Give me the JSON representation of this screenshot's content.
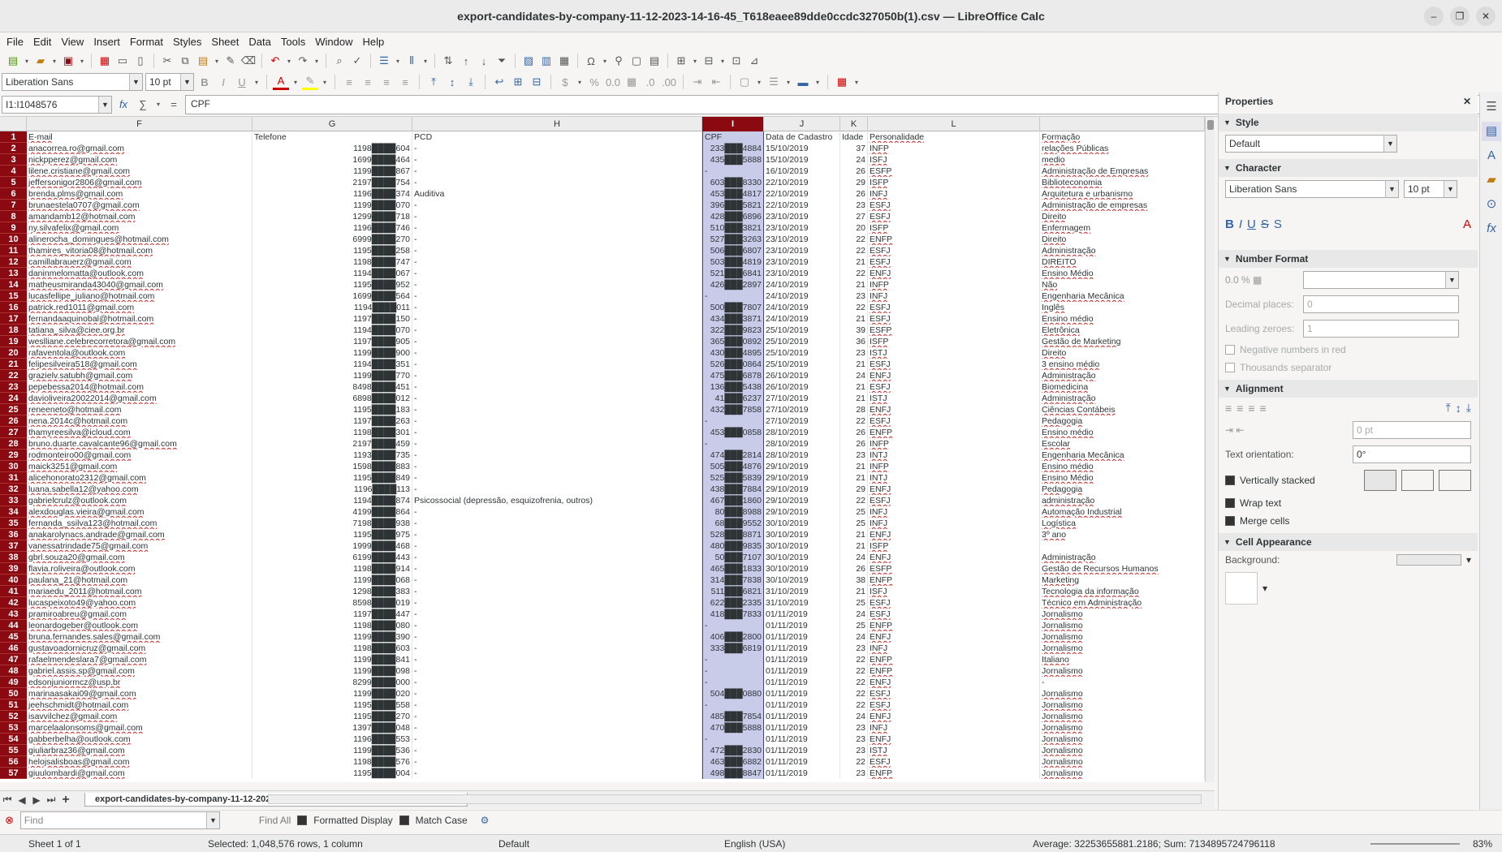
{
  "window": {
    "title": "export-candidates-by-company-11-12-2023-14-16-45_T618eaee89dde0ccdc327050b(1).csv — LibreOffice Calc"
  },
  "menu": [
    "File",
    "Edit",
    "View",
    "Insert",
    "Format",
    "Styles",
    "Sheet",
    "Data",
    "Tools",
    "Window",
    "Help"
  ],
  "format_bar": {
    "font_name": "Liberation Sans",
    "font_size": "10 pt"
  },
  "formula_bar": {
    "name_box": "I1:I1048576",
    "content": "CPF"
  },
  "columns": [
    {
      "id": "F",
      "label": "F"
    },
    {
      "id": "G",
      "label": "G"
    },
    {
      "id": "H",
      "label": "H"
    },
    {
      "id": "I",
      "label": "I"
    },
    {
      "id": "J",
      "label": "J"
    },
    {
      "id": "K",
      "label": "K"
    },
    {
      "id": "L",
      "label": "L"
    },
    {
      "id": "M",
      "label": ""
    }
  ],
  "rows": [
    {
      "n": "1",
      "email": "E-mail",
      "tel": "Telefone",
      "pcd": "PCD",
      "cpf": "CPF",
      "date": "Data de Cadastro",
      "age": "Idade",
      "pers": "Personalidade",
      "form": "Formação"
    },
    {
      "n": "2",
      "email": "anacorrea.ro@gmail.com",
      "tel": "1198████604",
      "pcd": "-",
      "cpf": "233███4884",
      "date": "15/10/2019",
      "age": "37",
      "pers": "INFP",
      "form": "relações Públicas"
    },
    {
      "n": "3",
      "email": "nickpperez@gmail.com",
      "tel": "1699████464",
      "pcd": "-",
      "cpf": "435███5888",
      "date": "15/10/2019",
      "age": "24",
      "pers": "ISFJ",
      "form": "medio"
    },
    {
      "n": "4",
      "email": "lilene.cristiane@gmail.com",
      "tel": "1199████867",
      "pcd": "-",
      "cpf": "-",
      "date": "16/10/2019",
      "age": "26",
      "pers": "ESFP",
      "form": "Administração de Empresas"
    },
    {
      "n": "5",
      "email": "jeffersonigor2806@gmail.com",
      "tel": "2197████754",
      "pcd": "-",
      "cpf": "603███8330",
      "date": "22/10/2019",
      "age": "29",
      "pers": "ISFP",
      "form": "Biblioteconomia"
    },
    {
      "n": "6",
      "email": "brenda.plms@gmail.com",
      "tel": "1196████374",
      "pcd": "Auditiva",
      "cpf": "453███4817",
      "date": "22/10/2019",
      "age": "26",
      "pers": "INFJ",
      "form": "Arquitetura e urbanismo"
    },
    {
      "n": "7",
      "email": "brunaestela0707@gmail.com",
      "tel": "1199████070",
      "pcd": "-",
      "cpf": "396███5821",
      "date": "22/10/2019",
      "age": "23",
      "pers": "ESFJ",
      "form": "Administração de empresas"
    },
    {
      "n": "8",
      "email": "amandamb12@hotmail.com",
      "tel": "1299████718",
      "pcd": "-",
      "cpf": "428███6896",
      "date": "23/10/2019",
      "age": "27",
      "pers": "ESFJ",
      "form": "Direito"
    },
    {
      "n": "9",
      "email": "ny.silvafelix@gmail.com",
      "tel": "1196████746",
      "pcd": "-",
      "cpf": "510███3821",
      "date": "23/10/2019",
      "age": "20",
      "pers": "ISFP",
      "form": "Enfermagem"
    },
    {
      "n": "10",
      "email": "alinerocha_domingues@hotmail.com",
      "tel": "6999████270",
      "pcd": "-",
      "cpf": "527███3263",
      "date": "23/10/2019",
      "age": "22",
      "pers": "ENFP",
      "form": "Direito"
    },
    {
      "n": "11",
      "email": "thamires_vitoria08@hotmail.com",
      "tel": "1195████258",
      "pcd": "-",
      "cpf": "506███6807",
      "date": "23/10/2019",
      "age": "22",
      "pers": "ESFJ",
      "form": "Administração"
    },
    {
      "n": "12",
      "email": "camillabrauerz@gmail.com",
      "tel": "1198████747",
      "pcd": "-",
      "cpf": "503███4819",
      "date": "23/10/2019",
      "age": "21",
      "pers": "ESFJ",
      "form": "DIREITO"
    },
    {
      "n": "13",
      "email": "daninmelomatta@outlook.com",
      "tel": "1194████067",
      "pcd": "-",
      "cpf": "521███6841",
      "date": "23/10/2019",
      "age": "22",
      "pers": "ENFJ",
      "form": "Ensino Médio"
    },
    {
      "n": "14",
      "email": "matheusmiranda43040@gmail.com",
      "tel": "1195████952",
      "pcd": "-",
      "cpf": "426███2897",
      "date": "24/10/2019",
      "age": "21",
      "pers": "INFP",
      "form": "Não"
    },
    {
      "n": "15",
      "email": "lucasfellipe_juliano@hotmail.com",
      "tel": "1699████564",
      "pcd": "-",
      "cpf": "-",
      "date": "24/10/2019",
      "age": "23",
      "pers": "INFJ",
      "form": "Engenharia Mecânica"
    },
    {
      "n": "16",
      "email": "patrick.red1011@gmail.com",
      "tel": "1194████011",
      "pcd": "-",
      "cpf": "500███7807",
      "date": "24/10/2019",
      "age": "22",
      "pers": "ESFJ",
      "form": "Inglês"
    },
    {
      "n": "17",
      "email": "fernandaaquinobal@hotmail.com",
      "tel": "1197████150",
      "pcd": "-",
      "cpf": "434███3871",
      "date": "24/10/2019",
      "age": "21",
      "pers": "ESFJ",
      "form": "Ensino médio"
    },
    {
      "n": "18",
      "email": "tatiana_silva@ciee.org.br",
      "tel": "1194████070",
      "pcd": "-",
      "cpf": "322███9823",
      "date": "25/10/2019",
      "age": "39",
      "pers": "ESFP",
      "form": "Eletrônica"
    },
    {
      "n": "19",
      "email": "weslliane.celebrecorretora@gmail.com",
      "tel": "1197████905",
      "pcd": "-",
      "cpf": "365███0892",
      "date": "25/10/2019",
      "age": "36",
      "pers": "ISFP",
      "form": "Gestão de Marketing"
    },
    {
      "n": "20",
      "email": "rafaventola@outlook.com",
      "tel": "1199████900",
      "pcd": "-",
      "cpf": "430███4895",
      "date": "25/10/2019",
      "age": "23",
      "pers": "ISTJ",
      "form": "Direito"
    },
    {
      "n": "21",
      "email": "felipesilveira518@gmail.com",
      "tel": "1194████351",
      "pcd": "-",
      "cpf": "526███0864",
      "date": "25/10/2019",
      "age": "21",
      "pers": "ESFJ",
      "form": "3 ensino médio"
    },
    {
      "n": "22",
      "email": "grazielv.satubh@gmail.com",
      "tel": "1199████770",
      "pcd": "-",
      "cpf": "475███6878",
      "date": "26/10/2019",
      "age": "24",
      "pers": "ENFJ",
      "form": "Administração"
    },
    {
      "n": "23",
      "email": "pepebessa2014@hotmail.com",
      "tel": "8498████451",
      "pcd": "-",
      "cpf": "136███5438",
      "date": "26/10/2019",
      "age": "21",
      "pers": "ESFJ",
      "form": "Biomedicina"
    },
    {
      "n": "24",
      "email": "davioliveira20022014@gmail.com",
      "tel": "6898████012",
      "pcd": "-",
      "cpf": "41███6237",
      "date": "27/10/2019",
      "age": "21",
      "pers": "ISTJ",
      "form": "Administração"
    },
    {
      "n": "25",
      "email": "reneeneto@hotmail.com",
      "tel": "1195████183",
      "pcd": "-",
      "cpf": "432███7858",
      "date": "27/10/2019",
      "age": "28",
      "pers": "ENFJ",
      "form": "Ciências Contábeis"
    },
    {
      "n": "26",
      "email": "nena.2014c@hotmail.com",
      "tel": "1197████263",
      "pcd": "-",
      "cpf": "-",
      "date": "27/10/2019",
      "age": "22",
      "pers": "ESFJ",
      "form": "Pedagogia"
    },
    {
      "n": "27",
      "email": "thamyreesilva@icloud.com",
      "tel": "1198████301",
      "pcd": "-",
      "cpf": "453███0858",
      "date": "28/10/2019",
      "age": "26",
      "pers": "ENFP",
      "form": "Ensino médio"
    },
    {
      "n": "28",
      "email": "bruno.duarte.cavalcante96@gmail.com",
      "tel": "2197████459",
      "pcd": "-",
      "cpf": "-",
      "date": "28/10/2019",
      "age": "26",
      "pers": "INFP",
      "form": "Escolar"
    },
    {
      "n": "29",
      "email": "rodmonteiro00@gmail.com",
      "tel": "1193████735",
      "pcd": "-",
      "cpf": "474███2814",
      "date": "28/10/2019",
      "age": "23",
      "pers": "INTJ",
      "form": "Engenharia Mecânica"
    },
    {
      "n": "30",
      "email": "maick3251@gmail.com",
      "tel": "1598████883",
      "pcd": "-",
      "cpf": "505███4876",
      "date": "29/10/2019",
      "age": "21",
      "pers": "INFP",
      "form": "Ensino médio"
    },
    {
      "n": "31",
      "email": "alicehonorato2312@gmail.com",
      "tel": "1195████849",
      "pcd": "-",
      "cpf": "525███5839",
      "date": "29/10/2019",
      "age": "21",
      "pers": "INTJ",
      "form": "Ensino Médio"
    },
    {
      "n": "32",
      "email": "luana.sabella12@yahoo.com",
      "tel": "1196████113",
      "pcd": "-",
      "cpf": "438███7884",
      "date": "29/10/2019",
      "age": "29",
      "pers": "ENFJ",
      "form": "Pedagogia"
    },
    {
      "n": "33",
      "email": "gabrielcrulz@outlook.com",
      "tel": "1194████874",
      "pcd": "Psicossocial (depressão, esquizofrenia, outros)",
      "cpf": "467███1860",
      "date": "29/10/2019",
      "age": "22",
      "pers": "ESFJ",
      "form": "administração"
    },
    {
      "n": "34",
      "email": "alexdouglas.vieira@gmail.com",
      "tel": "4199████864",
      "pcd": "-",
      "cpf": "80███8988",
      "date": "29/10/2019",
      "age": "25",
      "pers": "INFJ",
      "form": "Automação Industrial"
    },
    {
      "n": "35",
      "email": "fernanda_ssilva123@hotmail.com",
      "tel": "7198████938",
      "pcd": "-",
      "cpf": "68███9552",
      "date": "30/10/2019",
      "age": "25",
      "pers": "INFJ",
      "form": "Logística"
    },
    {
      "n": "36",
      "email": "anakarolynacs.andrade@gmail.com",
      "tel": "1195████975",
      "pcd": "-",
      "cpf": "528███8871",
      "date": "30/10/2019",
      "age": "21",
      "pers": "ENFJ",
      "form": "3º ano"
    },
    {
      "n": "37",
      "email": "vanessatrindade75@gmail.com",
      "tel": "1999████468",
      "pcd": "-",
      "cpf": "480███9835",
      "date": "30/10/2019",
      "age": "21",
      "pers": "ISFP",
      "form": ""
    },
    {
      "n": "38",
      "email": "gbrl.souza20@gmail.com",
      "tel": "6199████443",
      "pcd": "-",
      "cpf": "50███7107",
      "date": "30/10/2019",
      "age": "24",
      "pers": "ENFJ",
      "form": "Administração"
    },
    {
      "n": "39",
      "email": "flavia.roliveira@outlook.com",
      "tel": "1198████914",
      "pcd": "-",
      "cpf": "465███1833",
      "date": "30/10/2019",
      "age": "26",
      "pers": "ESFP",
      "form": "Gestão de Recursos Humanos"
    },
    {
      "n": "40",
      "email": "paulana_21@hotmail.com",
      "tel": "1199████068",
      "pcd": "-",
      "cpf": "314███7838",
      "date": "30/10/2019",
      "age": "38",
      "pers": "ENFP",
      "form": "Marketing"
    },
    {
      "n": "41",
      "email": "mariaedu_2011@hotmail.com",
      "tel": "1298████383",
      "pcd": "-",
      "cpf": "511███6821",
      "date": "31/10/2019",
      "age": "21",
      "pers": "ISFJ",
      "form": "Tecnologia da informação"
    },
    {
      "n": "42",
      "email": "lucaspeixoto49@yahoo.com",
      "tel": "8598████019",
      "pcd": "-",
      "cpf": "622███2335",
      "date": "31/10/2019",
      "age": "25",
      "pers": "ESFJ",
      "form": "Técnico em Administração"
    },
    {
      "n": "43",
      "email": "pramiroabreu@gmail.com",
      "tel": "1197████447",
      "pcd": "-",
      "cpf": "418███7833",
      "date": "01/11/2019",
      "age": "24",
      "pers": "ESFJ",
      "form": "Jornalismo"
    },
    {
      "n": "44",
      "email": "leonardogeber@outlook.com",
      "tel": "1198████080",
      "pcd": "-",
      "cpf": "-",
      "date": "01/11/2019",
      "age": "25",
      "pers": "ENFP",
      "form": "Jornalismo"
    },
    {
      "n": "45",
      "email": "bruna.fernandes.sales@gmail.com",
      "tel": "1199████390",
      "pcd": "-",
      "cpf": "406███2800",
      "date": "01/11/2019",
      "age": "24",
      "pers": "ENFJ",
      "form": "Jornalismo"
    },
    {
      "n": "46",
      "email": "gustavoadornicruz@gmail.com",
      "tel": "1198████603",
      "pcd": "-",
      "cpf": "333███6819",
      "date": "01/11/2019",
      "age": "23",
      "pers": "INFJ",
      "form": "Jornalismo"
    },
    {
      "n": "47",
      "email": "rafaelmendeslara7@gmail.com",
      "tel": "1199████841",
      "pcd": "-",
      "cpf": "-",
      "date": "01/11/2019",
      "age": "22",
      "pers": "ENFP",
      "form": "Italiano"
    },
    {
      "n": "48",
      "email": "gabriel.assis.sp@gmail.com",
      "tel": "1199████098",
      "pcd": "-",
      "cpf": "-",
      "date": "01/11/2019",
      "age": "22",
      "pers": "ENFP",
      "form": "Jornalismo"
    },
    {
      "n": "49",
      "email": "edsonjuniormcz@usp.br",
      "tel": "8299████000",
      "pcd": "-",
      "cpf": "-",
      "date": "01/11/2019",
      "age": "22",
      "pers": "ENFJ",
      "form": "-"
    },
    {
      "n": "50",
      "email": "marinaasakai09@gmail.com",
      "tel": "1199████020",
      "pcd": "-",
      "cpf": "504███0880",
      "date": "01/11/2019",
      "age": "22",
      "pers": "ESFJ",
      "form": "Jornalismo"
    },
    {
      "n": "51",
      "email": "jeehschmidt@hotmail.com",
      "tel": "1195████558",
      "pcd": "-",
      "cpf": "-",
      "date": "01/11/2019",
      "age": "22",
      "pers": "ESFJ",
      "form": "Jornalismo"
    },
    {
      "n": "52",
      "email": "isavvilchez@gmail.com",
      "tel": "1195████270",
      "pcd": "-",
      "cpf": "485███7854",
      "date": "01/11/2019",
      "age": "24",
      "pers": "ENFJ",
      "form": "Jornalismo"
    },
    {
      "n": "53",
      "email": "marcelaalonsoms@gmail.com",
      "tel": "1397████048",
      "pcd": "-",
      "cpf": "470███5888",
      "date": "01/11/2019",
      "age": "23",
      "pers": "INFJ",
      "form": "Jornalismo"
    },
    {
      "n": "54",
      "email": "gabberbelha@outlook.com",
      "tel": "1196████553",
      "pcd": "-",
      "cpf": "-",
      "date": "01/11/2019",
      "age": "23",
      "pers": "ENFJ",
      "form": "Jornalismo"
    },
    {
      "n": "55",
      "email": "giuliarbraz36@gmail.com",
      "tel": "1199████536",
      "pcd": "-",
      "cpf": "472███2830",
      "date": "01/11/2019",
      "age": "23",
      "pers": "ISTJ",
      "form": "Jornalismo"
    },
    {
      "n": "56",
      "email": "helojsalisboas@gmail.com",
      "tel": "1198████576",
      "pcd": "-",
      "cpf": "463███6882",
      "date": "01/11/2019",
      "age": "22",
      "pers": "ESFJ",
      "form": "Jornalismo"
    },
    {
      "n": "57",
      "email": "giuulombardi@gmail.com",
      "tel": "1195████004",
      "pcd": "-",
      "cpf": "498███8847",
      "date": "01/11/2019",
      "age": "23",
      "pers": "ENFP",
      "form": "Jornalismo"
    }
  ],
  "sheet_tab": "export-candidates-by-company-11-12-2023-14-16-45_T618eaee89dde0ccdc327050b(1)",
  "find": {
    "placeholder": "Find",
    "find_all": "Find All",
    "formatted_display": "Formatted Display",
    "match_case": "Match Case"
  },
  "status": {
    "sheet": "Sheet 1 of 1",
    "selection": "Selected: 1,048,576 rows, 1 column",
    "style": "Default",
    "language": "English (USA)",
    "stats": "Average: 32253655881.2186; Sum: 7134895724796118",
    "zoom": "83%"
  },
  "sidebar": {
    "title": "Properties",
    "style_section": "Style",
    "style_value": "Default",
    "character_section": "Character",
    "font_name": "Liberation Sans",
    "font_size": "10 pt",
    "number_format_section": "Number Format",
    "decimal_label": "Decimal places:",
    "decimal_value": "0",
    "leading_label": "Leading zeroes:",
    "leading_value": "1",
    "negative_red": "Negative numbers in red",
    "thousands_sep": "Thousands separator",
    "alignment_section": "Alignment",
    "indent_value": "0 pt",
    "text_orientation_label": "Text orientation:",
    "text_orientation_value": "0°",
    "vertically_stacked": "Vertically stacked",
    "wrap_text": "Wrap text",
    "merge_cells": "Merge cells",
    "cell_appearance_section": "Cell Appearance",
    "background_label": "Background:"
  }
}
